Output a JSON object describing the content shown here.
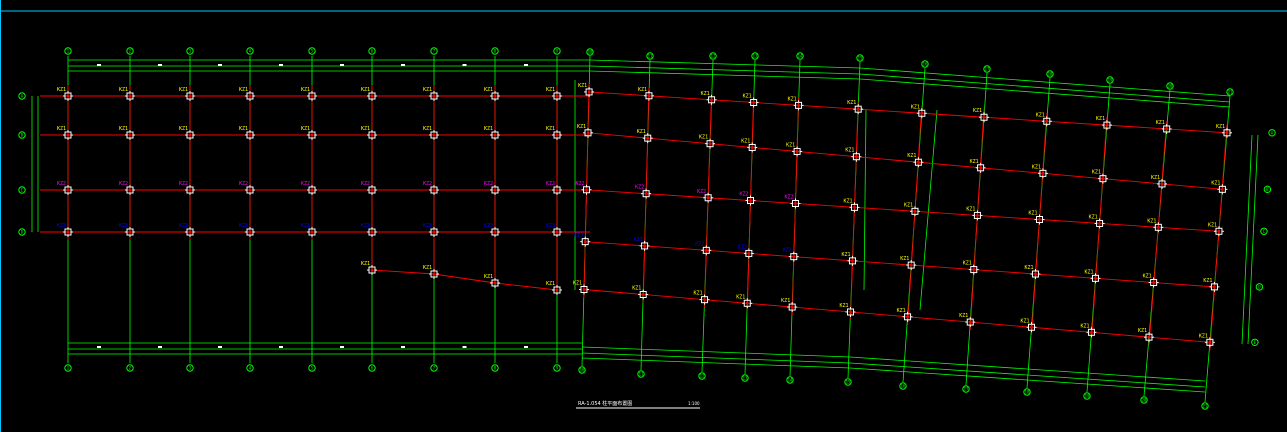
{
  "drawing": {
    "title": "RA-1.054 柱平面布置图",
    "scale": "1:100"
  },
  "colors": {
    "background": "#000000",
    "frame": "#00c8ff",
    "beam": "#ff0000",
    "axis": "#00ff00",
    "column": "#ffffff",
    "tag_yellow": "#ffff00",
    "tag_magenta": "#ff00ff",
    "tag_blue": "#0000ff"
  },
  "tag_text": {
    "yellow": "KZ1",
    "magenta": "KZ2",
    "blue": "KZ3"
  },
  "row_axes": [
    "A",
    "B",
    "C",
    "D"
  ],
  "right_row_axes": [
    "A",
    "B",
    "C",
    "D",
    "E"
  ],
  "top_axes_left": [
    "1",
    "2",
    "3",
    "4",
    "5",
    "6",
    "7",
    "8",
    "9"
  ],
  "top_axes_right": [
    "10",
    "11",
    "12",
    "13",
    "14",
    "15",
    "16",
    "17",
    "18",
    "19",
    "20",
    "21"
  ]
}
